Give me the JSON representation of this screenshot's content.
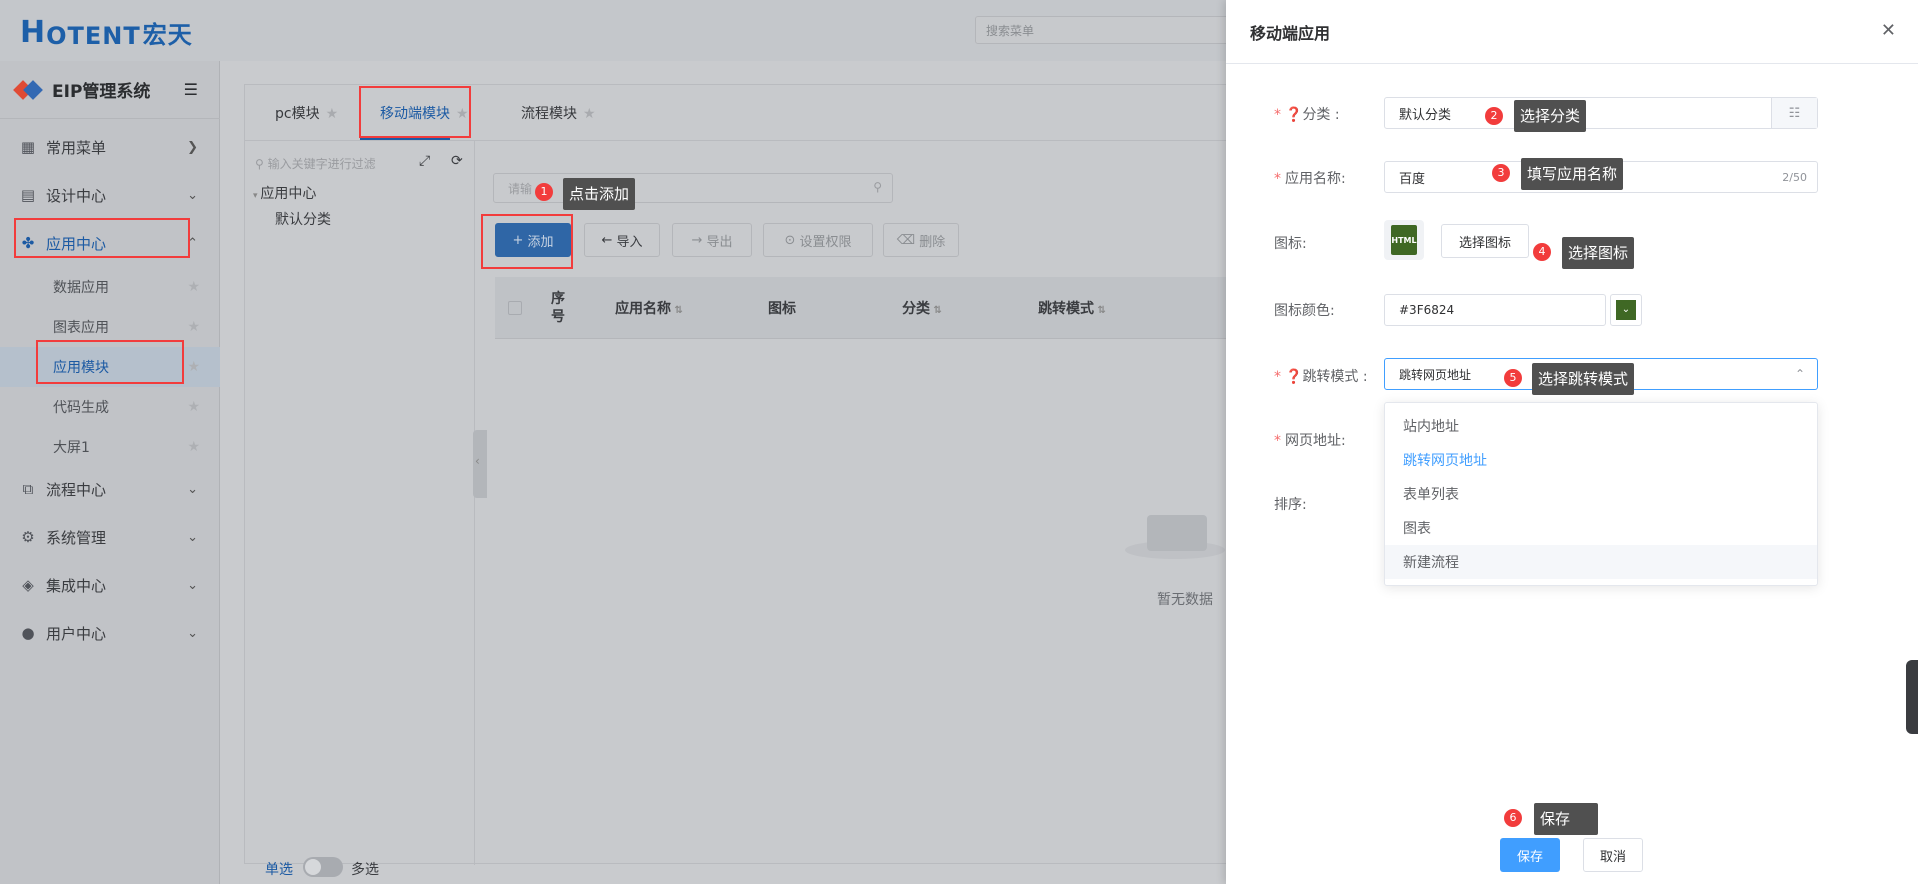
{
  "header": {
    "logo_letter": "H",
    "logo_rest": "OTENT",
    "logo_cn": "宏天",
    "search_placeholder": "搜索菜单"
  },
  "sidebar": {
    "brand": "EIP管理系统",
    "menus": [
      {
        "label": "常用菜单",
        "icon": "grid-icon"
      },
      {
        "label": "设计中心",
        "icon": "design-icon"
      },
      {
        "label": "应用中心",
        "icon": "apps-icon"
      },
      {
        "label": "流程中心",
        "icon": "flow-icon"
      },
      {
        "label": "系统管理",
        "icon": "gear-icon"
      },
      {
        "label": "集成中心",
        "icon": "layers-icon"
      },
      {
        "label": "用户中心",
        "icon": "user-icon"
      }
    ],
    "sub_items": [
      "数据应用",
      "图表应用",
      "应用模块",
      "代码生成",
      "大屏1"
    ]
  },
  "main": {
    "tabs": [
      "pc模块",
      "移动端模块",
      "流程模块"
    ],
    "tree_filter_placeholder": "输入关键字进行过滤",
    "tree_root": "应用中心",
    "tree_child": "默认分类",
    "list_search_placeholder": "请输",
    "toolbar": {
      "add": "添加",
      "import": "导入",
      "export": "导出",
      "permission": "设置权限",
      "delete": "删除"
    },
    "table_headers": [
      "序号",
      "应用名称",
      "图标",
      "分类",
      "跳转模式"
    ],
    "empty_text": "暂无数据",
    "single_select": "单选",
    "multi_select": "多选"
  },
  "drawer": {
    "title": "移动端应用",
    "fields": {
      "category_label": "分类 :",
      "category_value": "默认分类",
      "app_name_label": "应用名称:",
      "app_name_value": "百度",
      "app_name_count": "2/50",
      "icon_label": "图标:",
      "icon_preview_text": "HTML",
      "choose_icon": "选择图标",
      "icon_color_label": "图标颜色:",
      "icon_color_value": "#3F6824",
      "jump_mode_label": "跳转模式 :",
      "jump_mode_value": "跳转网页地址",
      "url_label": "网页地址:",
      "sort_label": "排序:"
    },
    "dropdown_options": [
      "站内地址",
      "跳转网页地址",
      "表单列表",
      "图表",
      "新建流程"
    ],
    "save": "保存",
    "cancel": "取消"
  },
  "annotations": [
    {
      "n": "1",
      "text": "点击添加"
    },
    {
      "n": "2",
      "text": "选择分类"
    },
    {
      "n": "3",
      "text": "填写应用名称"
    },
    {
      "n": "4",
      "text": "选择图标"
    },
    {
      "n": "5",
      "text": "选择跳转模式"
    },
    {
      "n": "6",
      "text": "保存"
    }
  ],
  "colors": {
    "primary": "#409eff",
    "accent_blue": "#1c5aa3",
    "required": "#f56c6c",
    "annotation_red": "#f23c3c",
    "icon_green": "#3F6824"
  }
}
